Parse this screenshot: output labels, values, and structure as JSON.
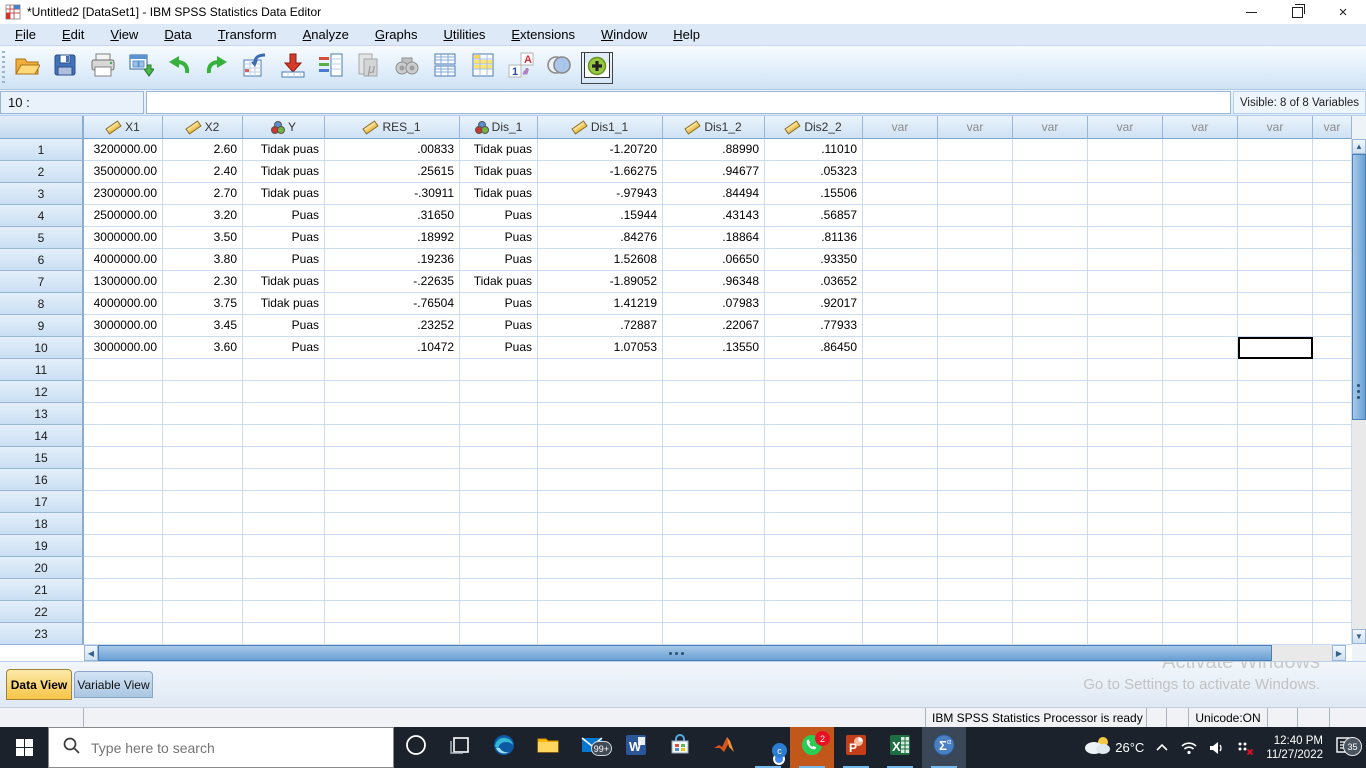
{
  "window": {
    "title": "*Untitled2 [DataSet1] - IBM SPSS Statistics Data Editor"
  },
  "menu": {
    "items": [
      "File",
      "Edit",
      "View",
      "Data",
      "Transform",
      "Analyze",
      "Graphs",
      "Utilities",
      "Extensions",
      "Window",
      "Help"
    ]
  },
  "toolbar": {
    "icons": [
      {
        "name": "open-file"
      },
      {
        "name": "save"
      },
      {
        "name": "print"
      },
      {
        "name": "recall-dialogs"
      },
      {
        "name": "undo"
      },
      {
        "name": "redo"
      },
      {
        "name": "goto-case"
      },
      {
        "name": "goto-variable"
      },
      {
        "name": "variables"
      },
      {
        "name": "descriptives",
        "disabled": true
      },
      {
        "name": "find",
        "disabled": true
      },
      {
        "name": "split-file"
      },
      {
        "name": "select-cases"
      },
      {
        "name": "value-labels"
      },
      {
        "name": "variable-sets"
      },
      {
        "name": "extensions-plus",
        "boxed": true
      }
    ]
  },
  "cellref": {
    "label": "10 :",
    "editor_value": "",
    "visible_info": "Visible: 8 of 8 Variables"
  },
  "grid": {
    "columns": [
      {
        "name": "X1",
        "type": "scale"
      },
      {
        "name": "X2",
        "type": "scale"
      },
      {
        "name": "Y",
        "type": "nominal"
      },
      {
        "name": "RES_1",
        "type": "scale"
      },
      {
        "name": "Dis_1",
        "type": "nominal"
      },
      {
        "name": "Dis1_1",
        "type": "scale"
      },
      {
        "name": "Dis1_2",
        "type": "scale"
      },
      {
        "name": "Dis2_2",
        "type": "scale"
      },
      {
        "name": "var",
        "type": "var"
      },
      {
        "name": "var",
        "type": "var"
      },
      {
        "name": "var",
        "type": "var"
      },
      {
        "name": "var",
        "type": "var"
      },
      {
        "name": "var",
        "type": "var"
      },
      {
        "name": "var",
        "type": "var"
      },
      {
        "name": "var",
        "type": "var"
      }
    ],
    "rows": [
      [
        "3200000.00",
        "2.60",
        "Tidak puas",
        ".00833",
        "Tidak puas",
        "-1.20720",
        ".88990",
        ".11010"
      ],
      [
        "3500000.00",
        "2.40",
        "Tidak puas",
        ".25615",
        "Tidak puas",
        "-1.66275",
        ".94677",
        ".05323"
      ],
      [
        "2300000.00",
        "2.70",
        "Tidak puas",
        "-.30911",
        "Tidak puas",
        "-.97943",
        ".84494",
        ".15506"
      ],
      [
        "2500000.00",
        "3.20",
        "Puas",
        ".31650",
        "Puas",
        ".15944",
        ".43143",
        ".56857"
      ],
      [
        "3000000.00",
        "3.50",
        "Puas",
        ".18992",
        "Puas",
        ".84276",
        ".18864",
        ".81136"
      ],
      [
        "4000000.00",
        "3.80",
        "Puas",
        ".19236",
        "Puas",
        "1.52608",
        ".06650",
        ".93350"
      ],
      [
        "1300000.00",
        "2.30",
        "Tidak puas",
        "-.22635",
        "Tidak puas",
        "-1.89052",
        ".96348",
        ".03652"
      ],
      [
        "4000000.00",
        "3.75",
        "Tidak puas",
        "-.76504",
        "Puas",
        "1.41219",
        ".07983",
        ".92017"
      ],
      [
        "3000000.00",
        "3.45",
        "Puas",
        ".23252",
        "Puas",
        ".72887",
        ".22067",
        ".77933"
      ],
      [
        "3000000.00",
        "3.60",
        "Puas",
        ".10472",
        "Puas",
        "1.07053",
        ".13550",
        ".86450"
      ]
    ],
    "total_rows": 23,
    "active_cell": {
      "row_index": 9,
      "col_index": 13
    }
  },
  "tabs": {
    "data_view": "Data View",
    "variable_view": "Variable View"
  },
  "statusbar": {
    "processor": "IBM SPSS Statistics Processor is ready",
    "unicode": "Unicode:ON"
  },
  "watermark": {
    "line1": "Activate Windows",
    "line2": "Go to Settings to activate Windows."
  },
  "taskbar": {
    "search_placeholder": "Type here to search",
    "apps": [
      {
        "name": "cortana"
      },
      {
        "name": "task-view"
      },
      {
        "name": "edge"
      },
      {
        "name": "file-explorer"
      },
      {
        "name": "mail",
        "badge": "99+",
        "badge_style": "dark"
      },
      {
        "name": "word"
      },
      {
        "name": "store"
      },
      {
        "name": "matlab"
      },
      {
        "name": "chrome",
        "badge": "c",
        "badge_style": "blue",
        "running": true
      },
      {
        "name": "whatsapp",
        "badge": "2",
        "attention": true,
        "running": true
      },
      {
        "name": "powerpoint",
        "running": true
      },
      {
        "name": "excel",
        "running": true
      },
      {
        "name": "spss",
        "active": true,
        "running": true
      }
    ],
    "tray": {
      "temperature": "26°C",
      "time": "12:40 PM",
      "date": "11/27/2022",
      "notification_count": "35"
    }
  },
  "colors": {
    "accent_blue": "#5b93d0",
    "header_blue": "#cfe2f4",
    "tab_active_gold": "#f7c548",
    "taskbar_dark": "#1b222b",
    "badge_red": "#e81123"
  }
}
